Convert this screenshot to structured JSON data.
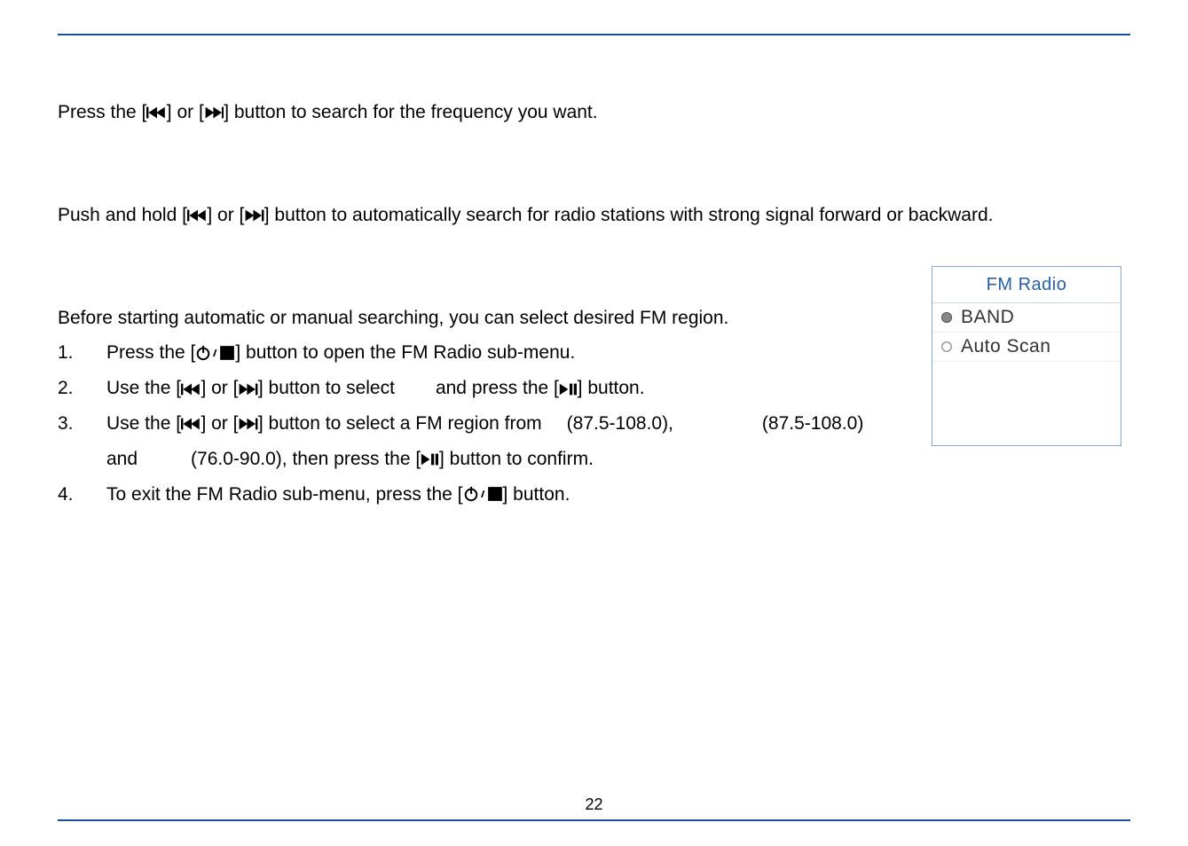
{
  "page_number": "22",
  "text": {
    "p1_a": "Press the [",
    "p1_b": "] or [",
    "p1_c": "] button to search for the frequency you want.",
    "p2_a": "Push and hold [",
    "p2_b": "] or [",
    "p2_c": "] button to automatically search for radio stations with strong signal forward or backward.",
    "p3": "Before starting automatic or manual searching, you can select desired FM region.",
    "n1": "1.",
    "l1_a": "Press the [",
    "l1_b": "] button to open the FM Radio sub-menu.",
    "n2": "2.",
    "l2_a": "Use the [",
    "l2_b": "] or [",
    "l2_c": "] button to select",
    "l2_d": "and press the [",
    "l2_e": "] button.",
    "n3": "3.",
    "l3_a": "Use the [",
    "l3_b": "] or [",
    "l3_c": "] button to select a FM region from",
    "l3_us_freq": "(87.5-108.0),",
    "l3_eu_freq": "(87.5-108.0)",
    "l3_and": "and",
    "l3_jp_freq": "(76.0-90.0), then press the [",
    "l3_tail": "] button to confirm.",
    "n4": "4.",
    "l4_a": "To exit the FM Radio sub-menu, press the [",
    "l4_b": "] button."
  },
  "panel": {
    "title": "FM Radio",
    "items": [
      {
        "label": "BAND",
        "selected": true
      },
      {
        "label": "Auto Scan",
        "selected": false
      }
    ]
  },
  "icons": {
    "prev": "previous-track-icon",
    "next": "next-track-icon",
    "playpause": "play-pause-icon",
    "powerstop": "power-stop-icon"
  }
}
